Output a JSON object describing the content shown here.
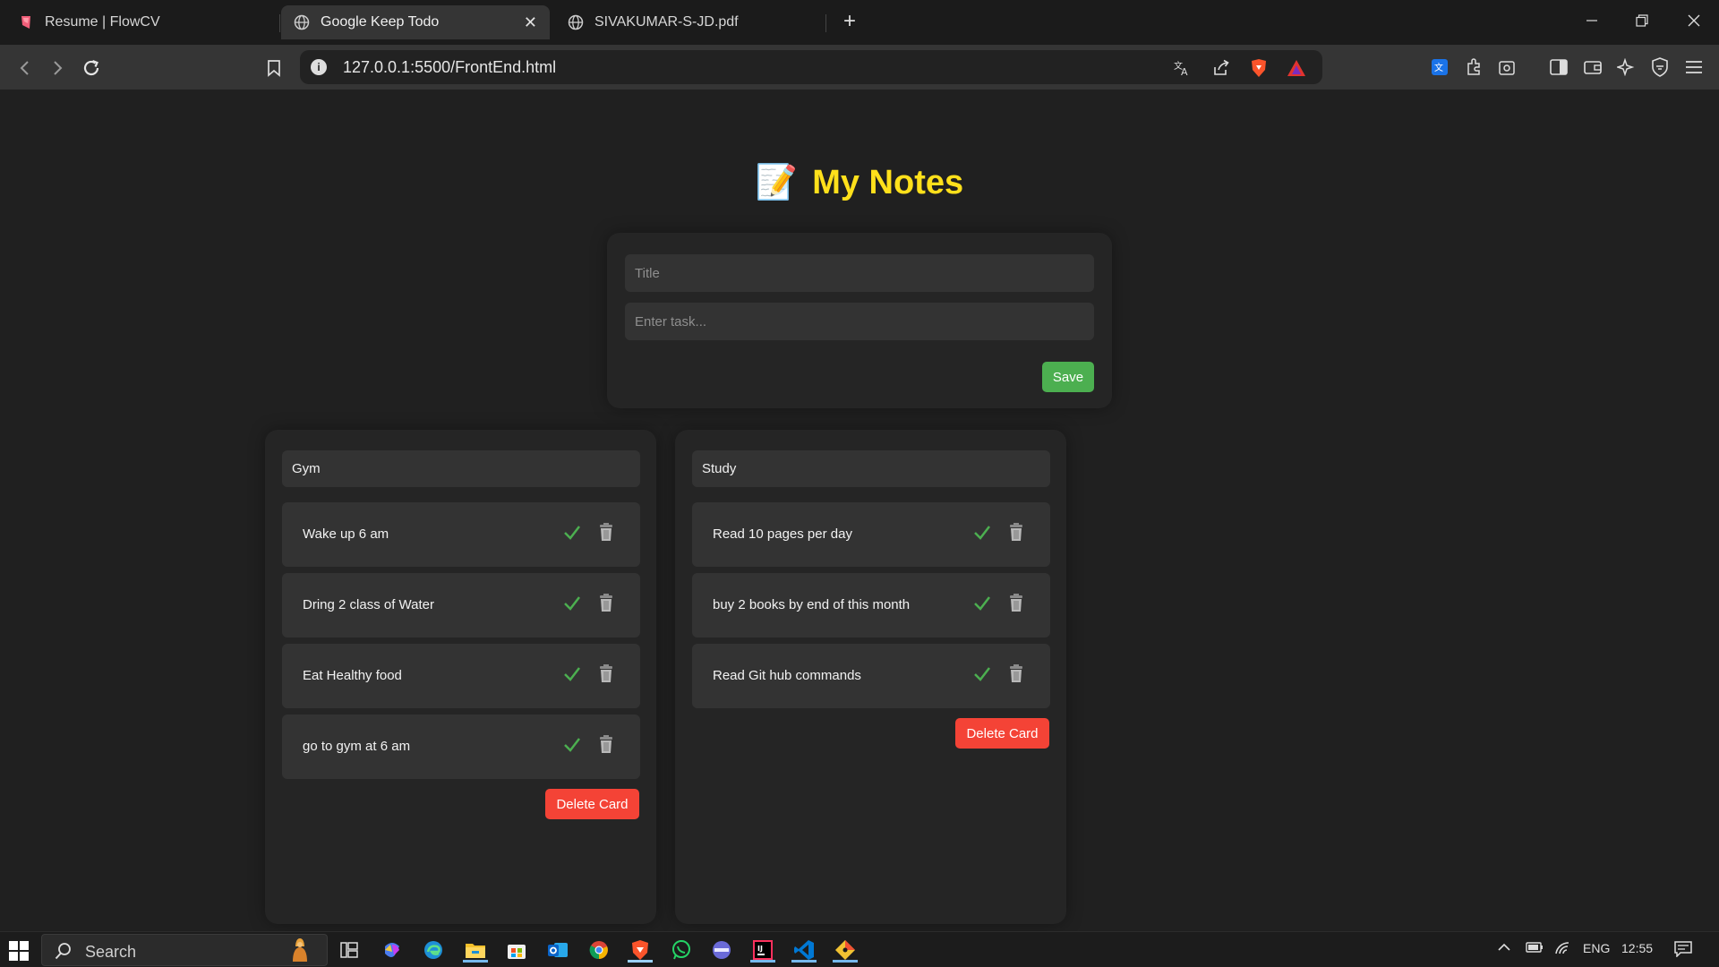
{
  "browser": {
    "tabs": [
      {
        "title": "Resume | FlowCV",
        "active": false
      },
      {
        "title": "Google Keep Todo",
        "active": true
      },
      {
        "title": "SIVAKUMAR-S-JD.pdf",
        "active": false
      }
    ],
    "url": "127.0.0.1:5500/FrontEnd.html"
  },
  "page": {
    "heading": "My Notes",
    "heading_emoji": "📝",
    "form": {
      "title_placeholder": "Title",
      "task_placeholder": "Enter task...",
      "save_label": "Save"
    },
    "cards": [
      {
        "title": "Gym",
        "tasks": [
          "Wake up 6 am",
          "Dring 2 class of Water",
          "Eat Healthy food",
          "go to gym at 6 am"
        ],
        "delete_label": "Delete Card"
      },
      {
        "title": "Study",
        "tasks": [
          "Read 10 pages per day",
          "buy 2 books by end of this month",
          "Read Git hub commands"
        ],
        "delete_label": "Delete Card"
      }
    ]
  },
  "taskbar": {
    "search_label": "Search",
    "language": "ENG",
    "time": "12:55"
  },
  "colors": {
    "background": "#202020",
    "heading": "#ffe01b",
    "save_button": "#4caf50",
    "delete_button": "#f44336",
    "check": "#4caf50"
  }
}
